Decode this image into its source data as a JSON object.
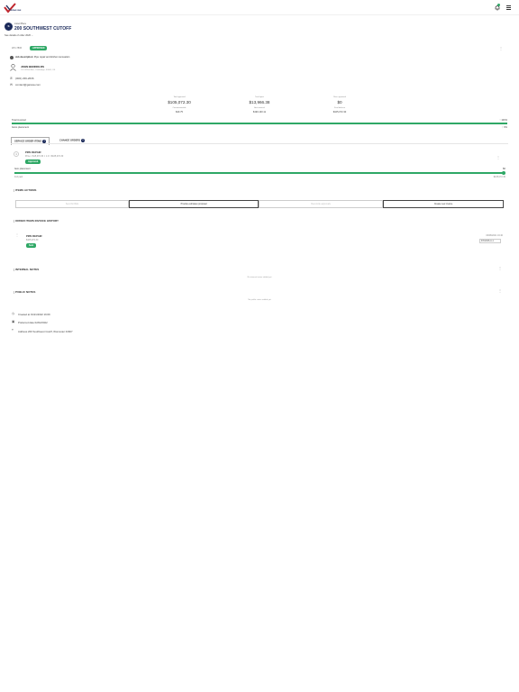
{
  "header": {
    "logo_text": "REPAIR ONE",
    "notifications_icon": "bell-icon",
    "menu_icon": "hamburger-icon",
    "brand_color": "#1b2a5a",
    "accent_color": "#2fa866"
  },
  "property": {
    "avatar_letter": "S",
    "label": "Listed Place",
    "title": "200 SOUTHWEST CUTOFF",
    "see_more": "See details of order 2026 ⌄"
  },
  "work_order": {
    "id": "WO-7806",
    "status": "APPROVED",
    "job_description_label": "Job description:",
    "job_description": "Pipe repair and kitchen renovation",
    "contact_name": "JOHN BENNOLDS",
    "contact_address": "101 Willow Ave, Cambridge, 00000, US",
    "phone": "(000) 239-2636",
    "email": "contact@gaiusa.com"
  },
  "stats": [
    {
      "label": "Total approved",
      "value": "$105,072.30",
      "sub_label": "Commissionable",
      "sub_value": "$40.75"
    },
    {
      "label": "Total spent",
      "value": "$13,966.38",
      "sub_label": "Amt invoiced",
      "sub_value": "$190,130.11"
    },
    {
      "label": "Rem. approved",
      "value": "$0",
      "sub_label": "Final balance",
      "sub_value": "$105,072.30"
    }
  ],
  "progress": {
    "total_invoiced_label": "Total invoiced",
    "total_invoiced_pct_text": "↑ 100%",
    "total_invoiced_fraction": 1.0,
    "items_placement_label": "Items placement",
    "items_placement_pct_text": "↑ 0%",
    "items_placement_fraction": 0.0
  },
  "tabs": [
    {
      "label": "SERVICE ORDER ITEMS",
      "count": "1"
    },
    {
      "label": "CHANGE ORDERS",
      "count": "0"
    }
  ],
  "line_item": {
    "number": "1",
    "title": "PIPE REPAIR",
    "sub": "Price × $15,072.30 × 1.0 = $105,072.30",
    "badge": "Approved",
    "placed_label": "Item placement",
    "placed_value": "$0",
    "left_caption": "Full paid",
    "right_caption": "$105,072.30",
    "placement_fraction": 1.0
  },
  "items_actions": {
    "title": "ITEMS ACTIONS",
    "buttons": [
      "Send for Bids",
      "Provide estimates proposal",
      "Reconcile approvals",
      "Create new invoice"
    ]
  },
  "invoice_history": {
    "title": "ORDER ITEMS INVOICE HISTORY",
    "entry_title": "PIPE REPAIR",
    "entry_amount": "$105,072.30",
    "entry_badge": "Sent",
    "entry_date": "06/08/2021 16:40",
    "entry_ref": "INV2026-A-1"
  },
  "internal_notes": {
    "title": "INTERNAL NOTES",
    "empty": "No internal notes added yet"
  },
  "public_notes": {
    "title": "PUBLIC NOTES",
    "empty": "No public notes added yet"
  },
  "meta": {
    "created": "Created at 01/21/2022 19:09",
    "preferred": "Preferred date 02/02/2022",
    "address": "Address 200 Southwest Cutoff, Worcester 01607"
  }
}
